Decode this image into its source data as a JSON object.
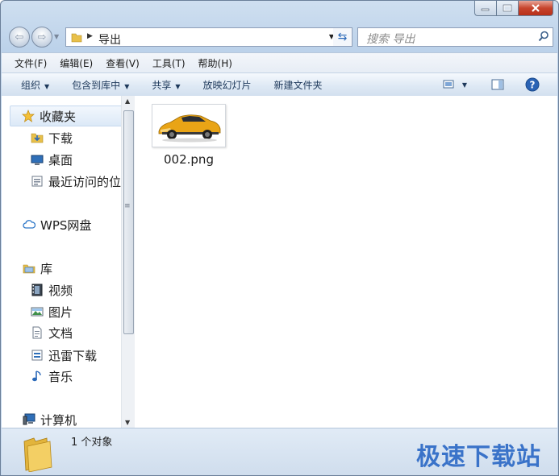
{
  "window": {
    "caption_min": "▭",
    "caption_max": "▢",
    "caption_close": "✕"
  },
  "address": {
    "crumb": "导出",
    "search_placeholder": "搜索 导出"
  },
  "menu": [
    "文件(F)",
    "编辑(E)",
    "查看(V)",
    "工具(T)",
    "帮助(H)"
  ],
  "toolbar": {
    "organize": "组织",
    "include_in_library": "包含到库中",
    "share": "共享",
    "slideshow": "放映幻灯片",
    "new_folder": "新建文件夹"
  },
  "nav": {
    "favorites": "收藏夹",
    "downloads": "下载",
    "desktop": "桌面",
    "recent": "最近访问的位",
    "wps": "WPS网盘",
    "libraries": "库",
    "videos": "视频",
    "pictures": "图片",
    "documents": "文档",
    "xunlei": "迅雷下载",
    "music": "音乐",
    "computer": "计算机"
  },
  "files": [
    {
      "name": "002.png",
      "icon": "car-thumbnail"
    }
  ],
  "status": {
    "count_text": "1 个对象"
  },
  "watermark": "极速下载站",
  "colors": {
    "accent": "#3a73c9",
    "window_frame": "#bcd2ea",
    "close": "#c7442d"
  }
}
